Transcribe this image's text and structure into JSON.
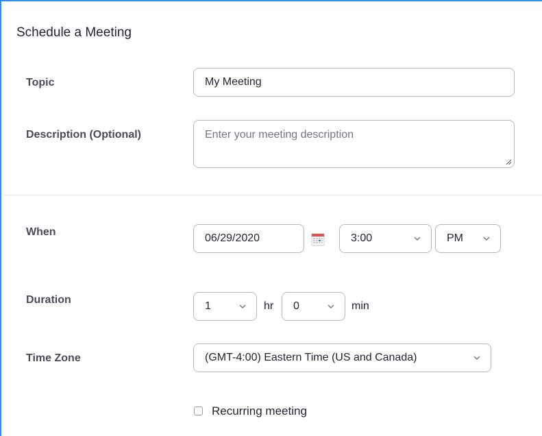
{
  "page": {
    "title": "Schedule a Meeting"
  },
  "topic": {
    "label": "Topic",
    "value": "My Meeting"
  },
  "description": {
    "label": "Description (Optional)",
    "placeholder": "Enter your meeting description"
  },
  "when": {
    "label": "When",
    "date": "06/29/2020",
    "time": "3:00",
    "ampm": "PM"
  },
  "duration": {
    "label": "Duration",
    "hours": "1",
    "hours_unit": "hr",
    "minutes": "0",
    "minutes_unit": "min"
  },
  "timezone": {
    "label": "Time Zone",
    "value": "(GMT-4:00) Eastern Time (US and Canada)"
  },
  "recurring": {
    "label": "Recurring meeting",
    "checked": false
  },
  "icons": {
    "calendar": "calendar-icon",
    "chevron": "chevron-down-icon"
  },
  "colors": {
    "accent": "#2d8cff",
    "border": "#b8b8c2",
    "label": "#4a4a5a",
    "text": "#232333"
  }
}
